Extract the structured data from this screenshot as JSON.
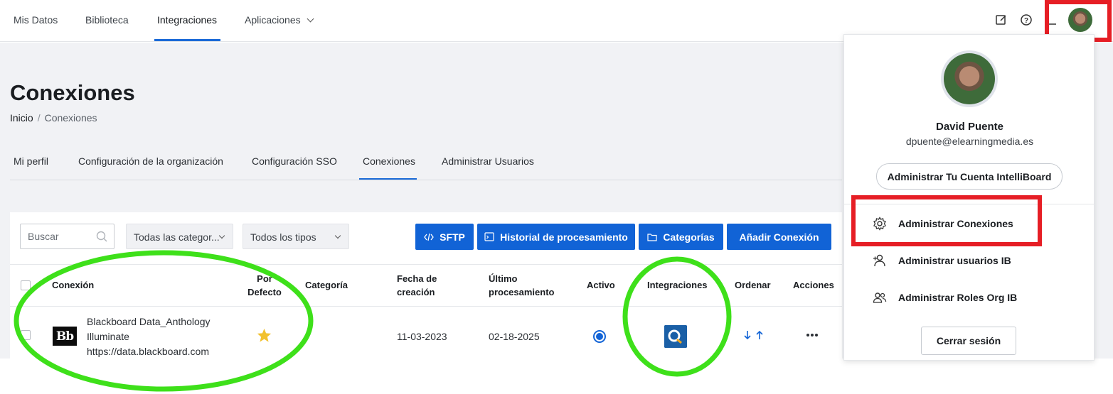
{
  "topnav": {
    "items": [
      "Mis Datos",
      "Biblioteca",
      "Integraciones",
      "Aplicaciones"
    ],
    "active": "Integraciones"
  },
  "page": {
    "title": "Conexiones",
    "breadcrumb": [
      "Inicio",
      "Conexiones"
    ]
  },
  "tabs": [
    "Mi perfil",
    "Configuración de la organización",
    "Configuración SSO",
    "Conexiones",
    "Administrar Usuarios"
  ],
  "toolbar": {
    "search_placeholder": "Buscar",
    "category_select": "Todas las categor...",
    "type_select": "Todos los tipos",
    "buttons": [
      "SFTP",
      "Historial de procesamiento",
      "Categorías",
      "Añadir Conexión"
    ]
  },
  "table": {
    "headers": {
      "connection": "Conexión",
      "default_line1": "Por",
      "default_line2": "Defecto",
      "category": "Categoría",
      "created_line1": "Fecha de",
      "created_line2": "creación",
      "processed_line1": "Último",
      "processed_line2": "procesamiento",
      "active": "Activo",
      "integrations": "Integraciones",
      "order": "Ordenar",
      "actions": "Acciones"
    },
    "rows": [
      {
        "logo_text": "Bb",
        "name_line1": "Blackboard Data_Anthology",
        "name_line2": "Illuminate",
        "url": "https://data.blackboard.com",
        "is_default": true,
        "category": "",
        "created": "11-03-2023",
        "last_processed": "02-18-2025",
        "active": true,
        "integration_icon": "q-integration-icon"
      }
    ]
  },
  "user_menu": {
    "name": "David Puente",
    "email": "dpuente@elearningmedia.es",
    "manage_account": "Administrar Tu Cuenta IntelliBoard",
    "items": [
      {
        "label": "Administrar Conexiones",
        "icon": "gear-icon"
      },
      {
        "label": "Administrar usuarios IB",
        "icon": "user-add-icon"
      },
      {
        "label": "Administrar Roles Org IB",
        "icon": "users-icon"
      }
    ],
    "logout": "Cerrar sesión"
  },
  "colors": {
    "accent": "#1163d6",
    "highlight_red": "#e61e25",
    "highlight_green": "#3ee01a",
    "star": "#f2c12e"
  }
}
